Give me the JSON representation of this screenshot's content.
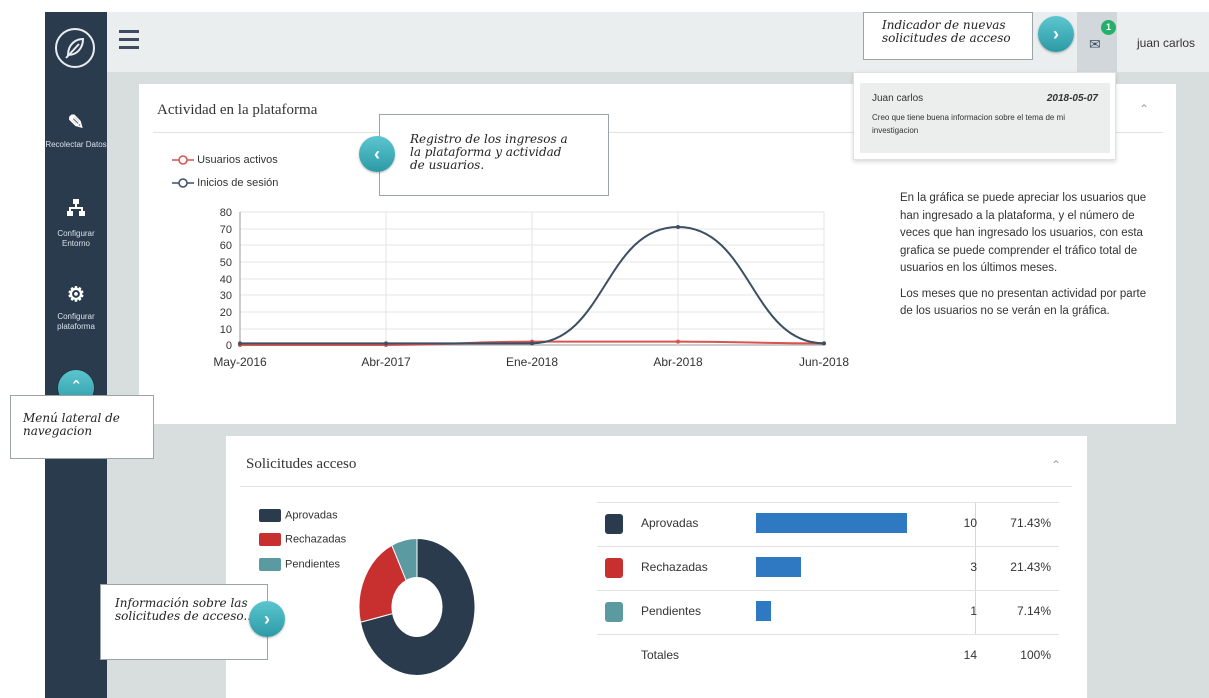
{
  "header": {
    "user": "juan carlos",
    "notification_count": "1"
  },
  "sidebar": {
    "items": [
      {
        "label": "Recolectar Datos",
        "icon": "edit-icon"
      },
      {
        "label": "Configurar Entorno",
        "icon": "sitemap-icon"
      },
      {
        "label": "Configurar plataforma",
        "icon": "gears-icon"
      }
    ]
  },
  "notification": {
    "name": "Juan carlos",
    "date": "2018-05-07",
    "message": "Creo que tiene buena informacion sobre el tema de mi investigacion"
  },
  "activity_panel": {
    "title": "Actividad en la plataforma",
    "legend": [
      "Usuarios activos",
      "Inicios de sesión"
    ],
    "description": [
      "En la gráfica se puede apreciar los usuarios que han ingresado a la plataforma, y el número de veces que han ingresado los usuarios, con esta grafica se puede comprender el tráfico total de usuarios en los últimos meses.",
      "Los meses que no presentan actividad por parte de los usuarios no se verán en la gráfica."
    ]
  },
  "requests_panel": {
    "title": "Solicitudes acceso",
    "legend": [
      "Aprovadas",
      "Rechazadas",
      "Pendientes"
    ],
    "rows": [
      {
        "label": "Aprovadas",
        "count": "10",
        "pct": "71.43%",
        "color": "#2b3b4e",
        "fraction": 0.7143
      },
      {
        "label": "Rechazadas",
        "count": "3",
        "pct": "21.43%",
        "color": "#c8302f",
        "fraction": 0.2143
      },
      {
        "label": "Pendientes",
        "count": "1",
        "pct": "7.14%",
        "color": "#5a9aa0",
        "fraction": 0.0714
      }
    ],
    "totals": {
      "label": "Totales",
      "count": "14",
      "pct": "100%"
    }
  },
  "callouts": {
    "notif": "Indicador de nuevas solicitudes de acceso",
    "registro": "Registro de los ingresos a la plataforma y actividad de usuarios.",
    "menu": "Menú lateral de navegacion",
    "info": "Información sobre las solicitudes de acceso.."
  },
  "colors": {
    "sidebar": "#2b3b4e",
    "accent": "#2f9fab",
    "badge": "#24b06b",
    "bar": "#2f78c2"
  },
  "chart_data": [
    {
      "type": "line",
      "x": [
        "May-2016",
        "Abr-2017",
        "Ene-2018",
        "Abr-2018",
        "Jun-2018"
      ],
      "series": [
        {
          "name": "Usuarios activos",
          "color": "#d9534f",
          "points": [
            [
              "May-2016",
              0
            ],
            [
              "Abr-2017",
              0
            ],
            [
              "Ene-2018",
              2
            ],
            [
              "Abr-2018",
              2
            ],
            [
              "Jun-2018",
              1
            ]
          ]
        },
        {
          "name": "Inicios de sesión",
          "color": "#3c4f63",
          "points": [
            [
              "May-2016",
              1
            ],
            [
              "Abr-2017",
              1
            ],
            [
              "Ene-2018",
              1
            ],
            [
              "Abr-2018",
              71
            ],
            [
              "Jun-2018",
              1
            ]
          ]
        }
      ],
      "yticks": [
        0,
        10,
        20,
        30,
        40,
        50,
        60,
        70,
        80
      ],
      "ylim": [
        0,
        80
      ],
      "grid": true,
      "legend": "top-left"
    },
    {
      "type": "pie",
      "labels": [
        "Aprovadas",
        "Rechazadas",
        "Pendientes"
      ],
      "values": [
        10,
        3,
        1
      ],
      "colors": [
        "#2b3b4e",
        "#c8302f",
        "#5a9aa0"
      ],
      "legend": "left"
    }
  ]
}
